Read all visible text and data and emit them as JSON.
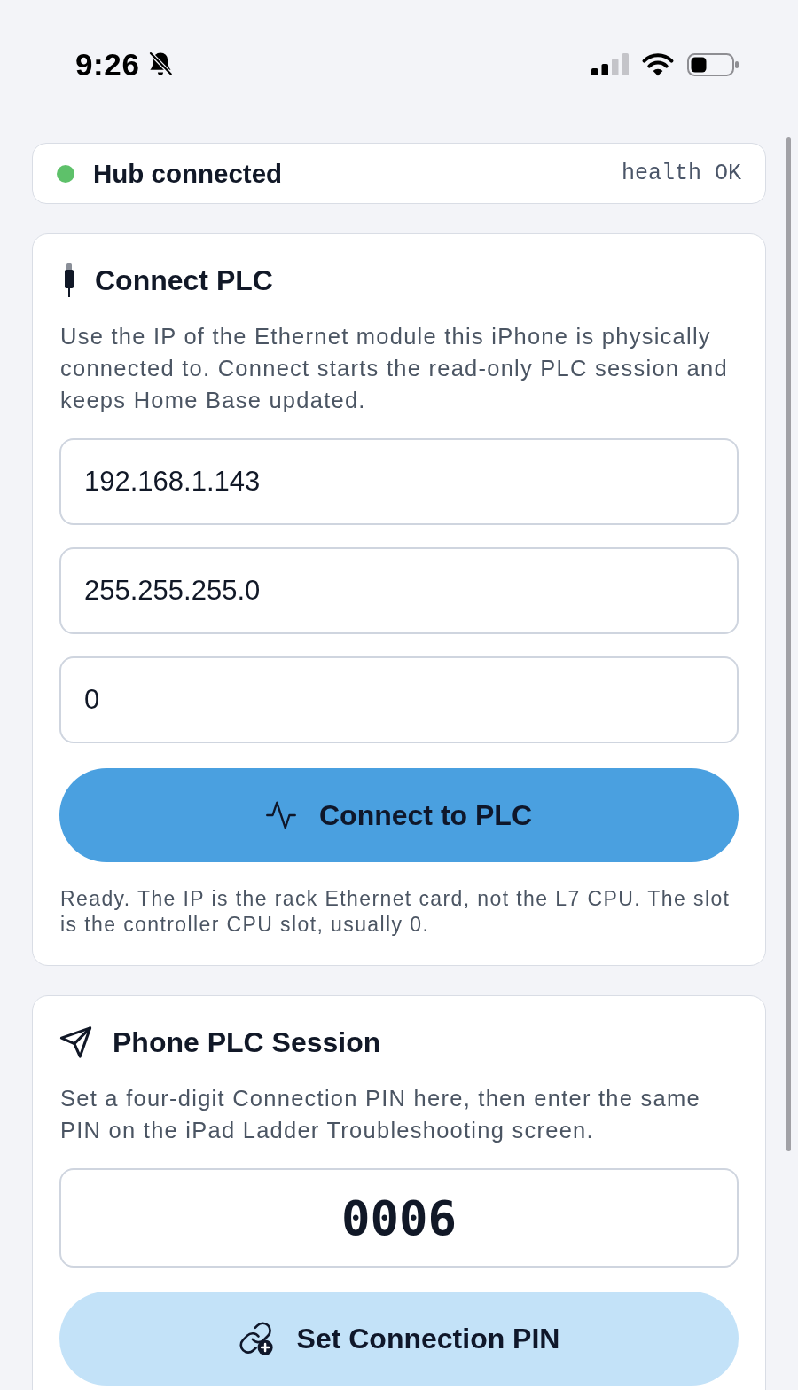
{
  "status_bar": {
    "time": "9:26"
  },
  "hub": {
    "label": "Hub connected",
    "connected": true,
    "health": "health OK"
  },
  "connect_plc": {
    "title": "Connect PLC",
    "description": "Use the IP of the Ethernet module this iPhone is physically connected to. Connect starts the read-only PLC session and keeps Home Base updated.",
    "fields": [
      {
        "value": "192.168.1.143"
      },
      {
        "value": "255.255.255.0"
      },
      {
        "value": "0"
      }
    ],
    "button": "Connect to PLC",
    "note": "Ready. The IP is the rack Ethernet card, not the L7 CPU. The slot is the controller CPU slot, usually 0."
  },
  "phone_session": {
    "title": "Phone PLC Session",
    "description": "Set a four-digit Connection PIN here, then enter the same PIN on the iPad Ladder Troubleshooting screen.",
    "pin": {
      "value": "0006"
    },
    "button": "Set Connection PIN"
  }
}
